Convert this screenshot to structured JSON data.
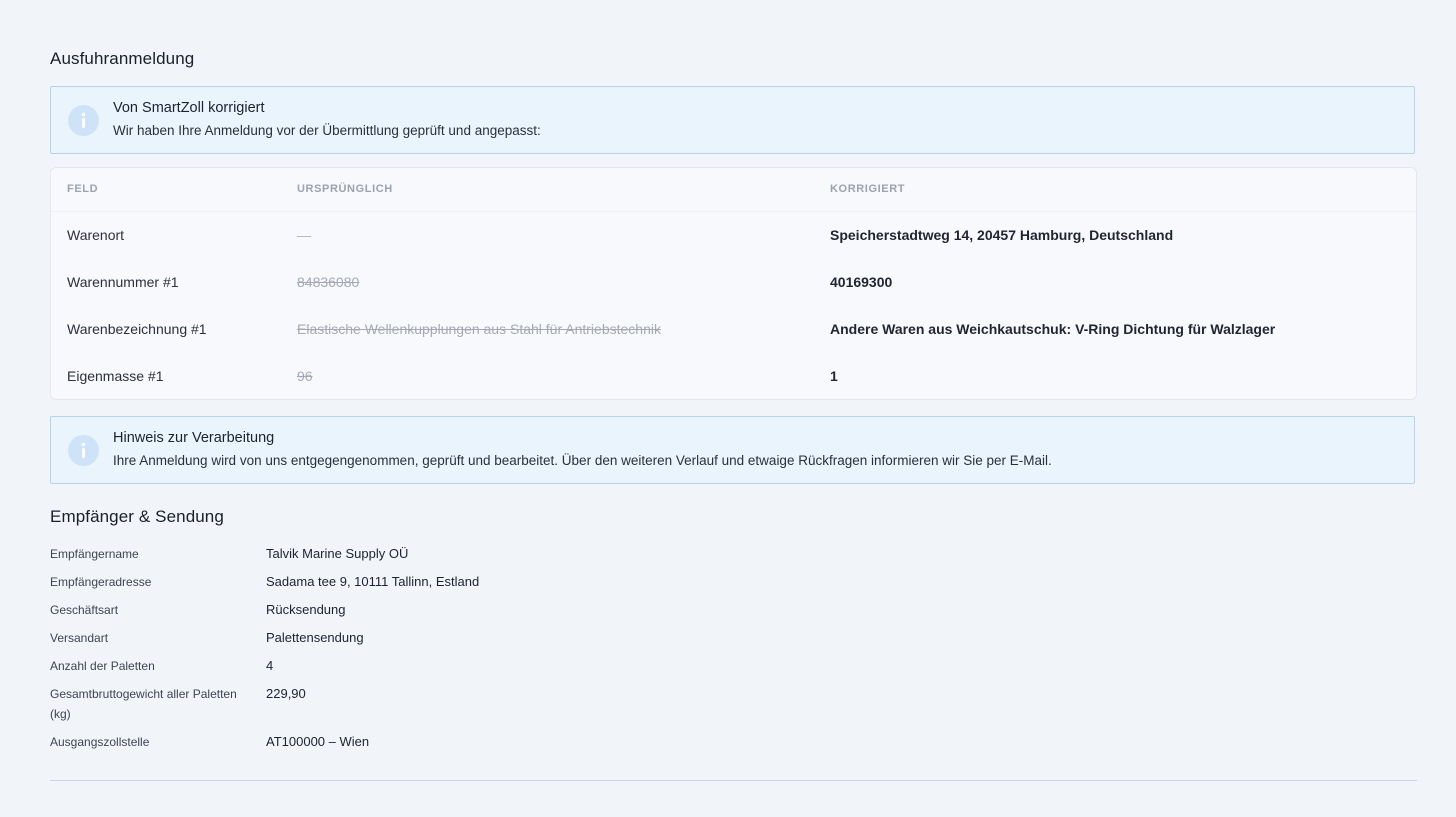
{
  "page_title": "Ausfuhranmeldung",
  "correction_notice": {
    "icon": "info-icon",
    "title": "Von SmartZoll korrigiert",
    "text": "Wir haben Ihre Anmeldung vor der Übermittlung geprüft und angepasst:"
  },
  "corrections_table": {
    "headers": [
      "FELD",
      "URSPRÜNGLICH",
      "KORRIGIERT"
    ],
    "rows": [
      {
        "field": "Warenort",
        "original": "—",
        "corrected": "Speicherstadtweg 14, 20457 Hamburg, Deutschland"
      },
      {
        "field": "Warennummer #1",
        "original": "84836080",
        "corrected": "40169300"
      },
      {
        "field": "Warenbezeichnung #1",
        "original": "Elastische Wellenkupplungen aus Stahl für Antriebstechnik",
        "corrected": "Andere Waren aus Weichkautschuk: V-Ring Dichtung für Walzlager"
      },
      {
        "field": "Eigenmasse #1",
        "original": "96",
        "corrected": "1"
      }
    ]
  },
  "processing_notice": {
    "icon": "info-icon",
    "title": "Hinweis zur Verarbeitung",
    "text": "Ihre Anmeldung wird von uns entgegengenommen, geprüft und bearbeitet. Über den weiteren Verlauf und etwaige Rückfragen informieren wir Sie per E-Mail."
  },
  "recipient_section": {
    "title": "Empfänger & Sendung",
    "items": [
      {
        "label": "Empfängername",
        "value": "Talvik Marine Supply OÜ"
      },
      {
        "label": "Empfängeradresse",
        "value": "Sadama tee 9, 10111 Tallinn, Estland"
      },
      {
        "label": "Geschäftsart",
        "value": "Rücksendung"
      },
      {
        "label": "Versandart",
        "value": "Palettensendung"
      },
      {
        "label": "Anzahl der Paletten",
        "value": "4"
      },
      {
        "label": "Gesamtbruttogewicht aller Paletten (kg)",
        "value": "229,90"
      },
      {
        "label": "Ausgangszollstelle",
        "value": "AT100000 – Wien"
      }
    ]
  }
}
